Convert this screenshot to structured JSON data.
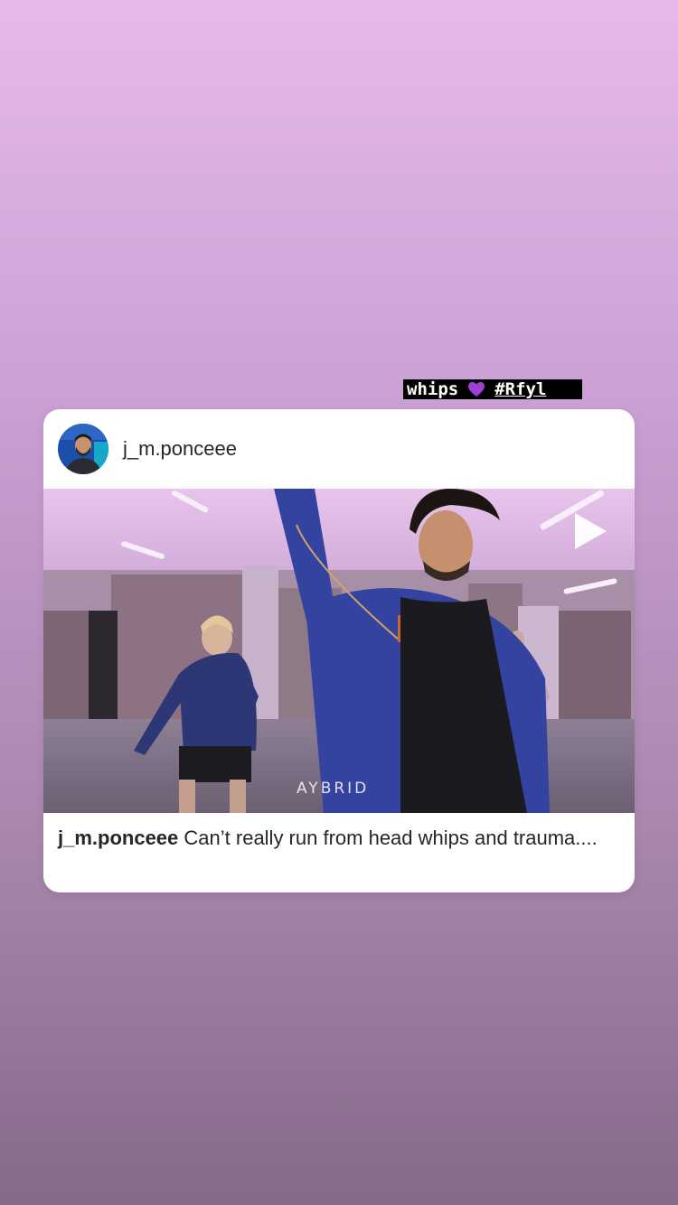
{
  "sticker": {
    "word": "whips",
    "emoji": "purple-heart-icon",
    "hashtag": "#Rfyl"
  },
  "post": {
    "username": "j_m.ponceee",
    "media": {
      "watermark": "AYBRID",
      "play_icon": "play-icon"
    },
    "caption": {
      "username": "j_m.ponceee",
      "text": "Can’t really run from head whips and trauma...."
    }
  },
  "colors": {
    "background_top": "#e7b9ea",
    "background_bottom": "#856a89",
    "card": "#ffffff",
    "text": "#262626",
    "heart": "#9b3fd6"
  }
}
